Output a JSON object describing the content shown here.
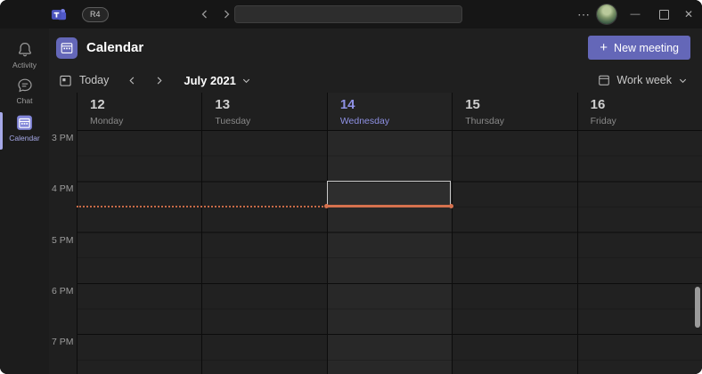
{
  "titlebar": {
    "badge": "R4",
    "more_glyph": "⋯",
    "minimize_glyph": "—",
    "close_glyph": "✕",
    "search_placeholder": ""
  },
  "sidebar": {
    "items": [
      {
        "label": "Activity"
      },
      {
        "label": "Chat"
      },
      {
        "label": "Calendar",
        "active": true
      }
    ]
  },
  "header": {
    "title": "Calendar",
    "plus_glyph": "+",
    "new_meeting_label": "New meeting"
  },
  "toolbar": {
    "today_label": "Today",
    "period_label": "July 2021",
    "view_label": "Work week"
  },
  "calendar": {
    "days": [
      {
        "date": "12",
        "name": "Monday"
      },
      {
        "date": "13",
        "name": "Tuesday"
      },
      {
        "date": "14",
        "name": "Wednesday"
      },
      {
        "date": "15",
        "name": "Thursday"
      },
      {
        "date": "16",
        "name": "Friday"
      }
    ],
    "current_day_index": 2,
    "hours": [
      "3 PM",
      "4 PM",
      "5 PM",
      "6 PM",
      "7 PM"
    ]
  },
  "colors": {
    "accent": "#6467b8",
    "current_time_line": "#d5714e",
    "current_day_text": "#8e91e4"
  }
}
